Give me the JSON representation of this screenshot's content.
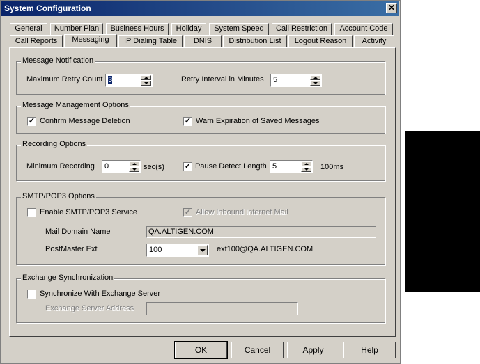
{
  "window": {
    "title": "System Configuration",
    "close_glyph": "✕"
  },
  "tabs_row1": [
    "General",
    "Number Plan",
    "Business Hours",
    "Holiday",
    "System Speed",
    "Call Restriction",
    "Account Code"
  ],
  "tabs_row2": [
    "Call Reports",
    "Messaging",
    "IP Dialing Table",
    "DNIS",
    "Distribution List",
    "Logout Reason",
    "Activity"
  ],
  "active_tab": "Messaging",
  "message_notification": {
    "title": "Message Notification",
    "max_retry_label": "Maximum Retry Count",
    "max_retry_value": "3",
    "retry_interval_label": "Retry Interval in Minutes",
    "retry_interval_value": "5"
  },
  "message_management": {
    "title": "Message Management Options",
    "confirm_deletion_label": "Confirm Message Deletion",
    "confirm_deletion_checked": true,
    "warn_expiration_label": "Warn Expiration of Saved Messages",
    "warn_expiration_checked": true
  },
  "recording": {
    "title": "Recording Options",
    "min_recording_label": "Minimum Recording",
    "min_recording_value": "0",
    "min_recording_unit": "sec(s)",
    "pause_detect_label": "Pause Detect Length",
    "pause_detect_checked": true,
    "pause_detect_value": "5",
    "pause_detect_unit": "100ms"
  },
  "smtp": {
    "title": "SMTP/POP3 Options",
    "enable_label": "Enable SMTP/POP3 Service",
    "enable_checked": false,
    "allow_inbound_label": "Allow Inbound Internet Mail",
    "allow_inbound_checked": true,
    "mail_domain_label": "Mail Domain Name",
    "mail_domain_value": "QA.ALTIGEN.COM",
    "postmaster_label": "PostMaster Ext",
    "postmaster_value": "100",
    "postmaster_address": "ext100@QA.ALTIGEN.COM"
  },
  "exchange": {
    "title": "Exchange Synchronization",
    "sync_label": "Synchronize With Exchange Server",
    "sync_checked": false,
    "server_address_label": "Exchange Server Address",
    "server_address_value": ""
  },
  "buttons": {
    "ok": "OK",
    "cancel": "Cancel",
    "apply": "Apply",
    "help": "Help"
  },
  "check_glyph": "✓"
}
